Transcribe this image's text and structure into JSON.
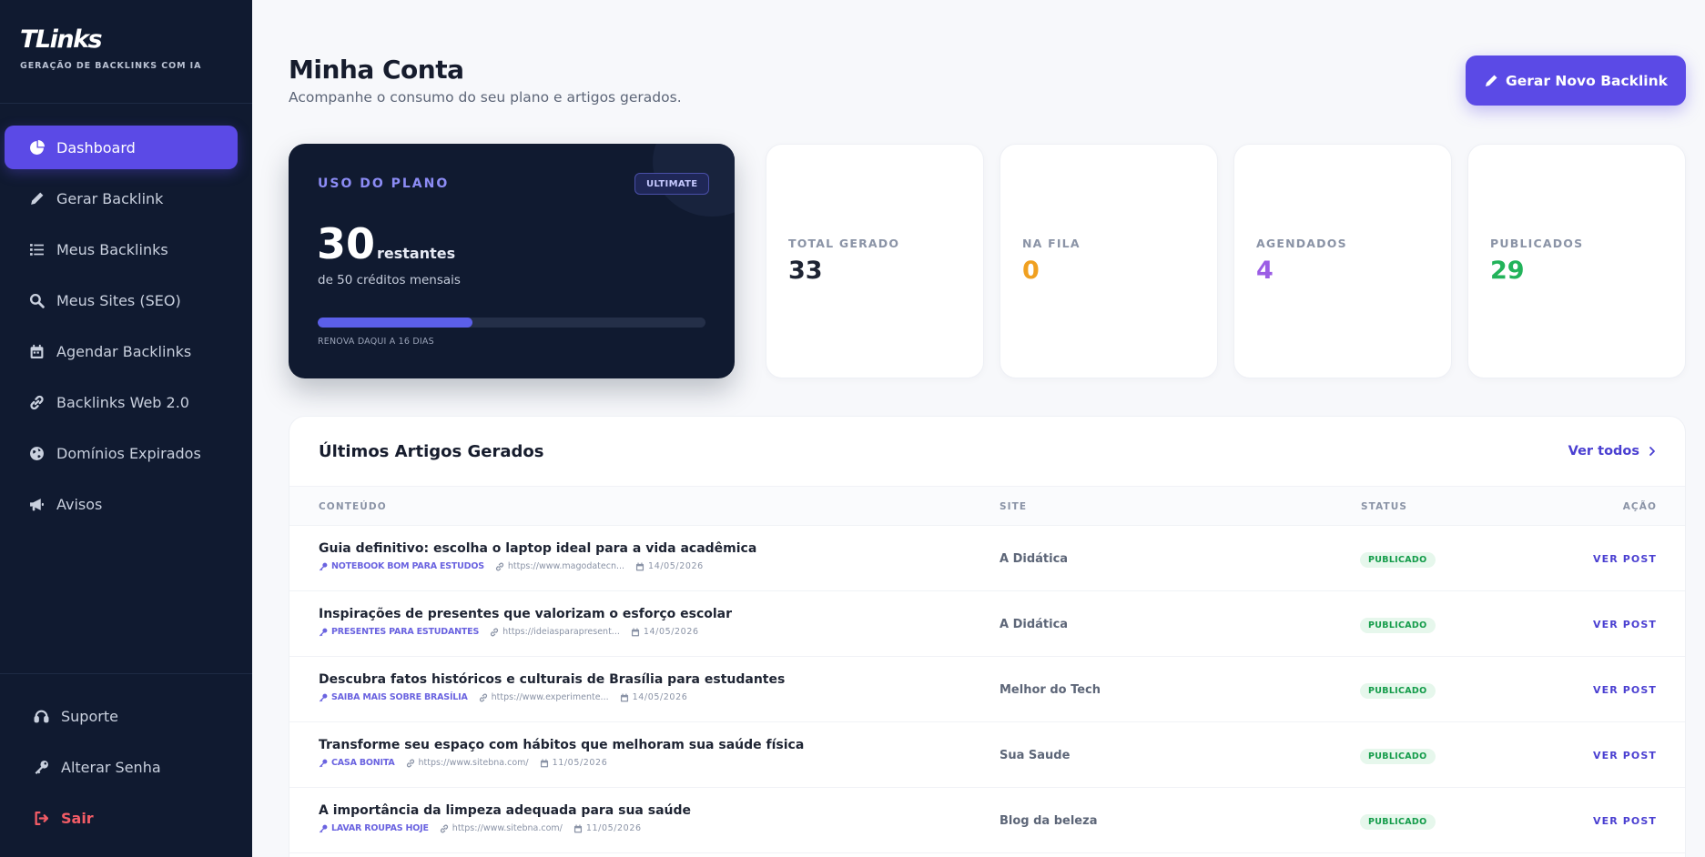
{
  "brand": {
    "logo": "TLinks",
    "tagline": "GERAÇÃO DE BACKLINKS COM IA"
  },
  "sidebar": {
    "items": [
      {
        "label": "Dashboard",
        "icon": "pie-chart-icon",
        "active": true
      },
      {
        "label": "Gerar Backlink",
        "icon": "pencil-icon"
      },
      {
        "label": "Meus Backlinks",
        "icon": "list-icon"
      },
      {
        "label": "Meus Sites (SEO)",
        "icon": "search-icon"
      },
      {
        "label": "Agendar Backlinks",
        "icon": "calendar-icon"
      },
      {
        "label": "Backlinks Web 2.0",
        "icon": "link-icon"
      },
      {
        "label": "Domínios Expirados",
        "icon": "globe-icon"
      },
      {
        "label": "Avisos",
        "icon": "megaphone-icon"
      }
    ],
    "bottom": [
      {
        "label": "Suporte",
        "icon": "headset-icon"
      },
      {
        "label": "Alterar Senha",
        "icon": "key-icon"
      },
      {
        "label": "Sair",
        "icon": "logout-icon"
      }
    ]
  },
  "header": {
    "title": "Minha Conta",
    "subtitle": "Acompanhe o consumo do seu plano e artigos gerados.",
    "cta_label": "Gerar Novo Backlink"
  },
  "plan": {
    "label": "USO DO PLANO",
    "badge": "ULTIMATE",
    "remaining": "30",
    "remaining_label": "restantes",
    "credits_text": "de 50 créditos mensais",
    "renew_text": "RENOVA DAQUI A 16 DIAS",
    "progress": 0.4
  },
  "stats": [
    {
      "label": "TOTAL GERADO",
      "value": "33",
      "color": "#1e2433"
    },
    {
      "label": "NA FILA",
      "value": "0",
      "color": "#f0a020"
    },
    {
      "label": "AGENDADOS",
      "value": "4",
      "color": "#9b5de5"
    },
    {
      "label": "PUBLICADOS",
      "value": "29",
      "color": "#22b35a"
    }
  ],
  "articles": {
    "title": "Últimos Artigos Gerados",
    "view_all": "Ver todos",
    "columns": {
      "content": "CONTEÚDO",
      "site": "SITE",
      "status": "STATUS",
      "action": "AÇÃO"
    },
    "rows": [
      {
        "title": "Guia definitivo: escolha o laptop ideal para a vida acadêmica",
        "keyword": "NOTEBOOK BOM PARA ESTUDOS",
        "url": "https://www.magodatecn...",
        "date": "14/05/2026",
        "site": "A Didática",
        "status": "PUBLICADO",
        "action": "VER POST"
      },
      {
        "title": "Inspirações de presentes que valorizam o esforço escolar",
        "keyword": "PRESENTES PARA ESTUDANTES",
        "url": "https://ideiasparapresent...",
        "date": "14/05/2026",
        "site": "A Didática",
        "status": "PUBLICADO",
        "action": "VER POST"
      },
      {
        "title": "Descubra fatos históricos e culturais de Brasília para estudantes",
        "keyword": "SAIBA MAIS SOBRE BRASÍLIA",
        "url": "https://www.experimente...",
        "date": "14/05/2026",
        "site": "Melhor do Tech",
        "status": "PUBLICADO",
        "action": "VER POST"
      },
      {
        "title": "Transforme seu espaço com hábitos que melhoram sua saúde física",
        "keyword": "CASA BONITA",
        "url": "https://www.sitebna.com/",
        "date": "11/05/2026",
        "site": "Sua Saude",
        "status": "PUBLICADO",
        "action": "VER POST"
      },
      {
        "title": "A importância da limpeza adequada para sua saúde",
        "keyword": "LAVAR ROUPAS HOJE",
        "url": "https://www.sitebna.com/",
        "date": "11/05/2026",
        "site": "Blog da beleza",
        "status": "PUBLICADO",
        "action": "VER POST"
      }
    ]
  }
}
